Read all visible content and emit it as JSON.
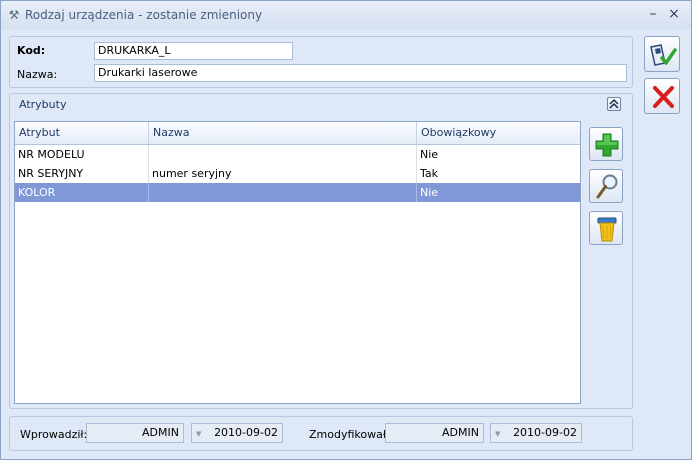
{
  "window": {
    "title": "Rodzaj urządzenia - zostanie zmieniony",
    "minimize_glyph": "–",
    "close_glyph": "×"
  },
  "form": {
    "kod_label": "Kod:",
    "kod_value": "DRUKARKA_L",
    "nazwa_label": "Nazwa:",
    "nazwa_value": "Drukarki laserowe"
  },
  "atrybuty": {
    "title": "Atrybuty",
    "columns": [
      "Atrybut",
      "Nazwa",
      "Obowiązkowy"
    ],
    "rows": [
      {
        "atrybut": "NR MODELU",
        "nazwa": "",
        "obowiazkowy": "Nie"
      },
      {
        "atrybut": "NR SERYJNY",
        "nazwa": "numer seryjny",
        "obowiazkowy": "Tak"
      },
      {
        "atrybut": "KOLOR",
        "nazwa": "",
        "obowiazkowy": "Nie",
        "selected": true
      }
    ]
  },
  "toolbar": {
    "save_icon": "save-check-icon",
    "cancel_icon": "red-x-icon",
    "add_icon": "green-plus-icon",
    "edit_icon": "magnifier-icon",
    "delete_icon": "trash-bin-icon"
  },
  "footer": {
    "wprowadzil_label": "Wprowadził:",
    "wprowadzil_user": "ADMIN",
    "wprowadzil_date": "2010-09-02",
    "zmodyfikowal_label": "Zmodyfikował:",
    "zmodyfikowal_user": "ADMIN",
    "zmodyfikowal_date": "2010-09-02"
  },
  "colors": {
    "selected_row": "#8098d8",
    "window_bg": "#dfe8f6",
    "accent_green": "#2fa82f",
    "accent_red": "#d81e1e"
  }
}
